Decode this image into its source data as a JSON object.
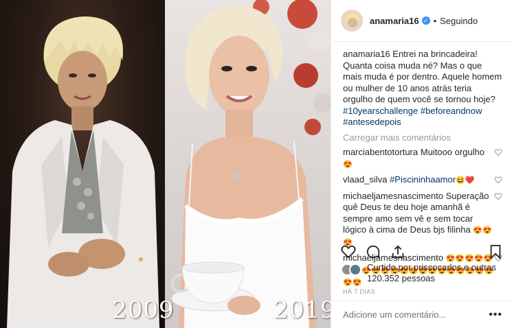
{
  "photo": {
    "year_left": "2009",
    "year_right": "2019"
  },
  "header": {
    "username": "anamaria16",
    "verified_mark": "✓",
    "separator": "•",
    "follow_status": "Seguindo"
  },
  "caption": {
    "username": "anamaria16",
    "text": "Entrei na brincadeira! Quanta coisa muda né? Mas o que mais muda é por dentro. Aquele homem ou mulher de 10 anos atrás teria orgulho de quem você se tornou hoje?",
    "hashtags": [
      "#10yearschallenge",
      "#beforeandnow",
      "#antesedepois"
    ]
  },
  "load_more": "Carregar mais comentários",
  "comments": [
    {
      "username": "marciabentotortura",
      "text": "Muitooo orgulho",
      "emoji": "😍"
    },
    {
      "username": "vlaad_silva",
      "text": "#Piscininhaamor",
      "emoji": "😆❤️"
    },
    {
      "username": "michaeljamesnascimento",
      "text": "Superação quê Deus te deu hoje amanhã é sempre amo sem vê e sem tocar lógico à cima de Deus bjs filinha",
      "emoji": "😍😍😍"
    },
    {
      "username": "michaeljamesnascimento",
      "text": "",
      "emoji": "😍😍😍😍😍😍😍😍😍😍😍😍😍😍😍😍😍😍😍😍😍😍😍"
    }
  ],
  "likes": {
    "text": "Curtido por priscocarlos e outras 120.352 pessoas"
  },
  "date": "HÁ 7 DIAS",
  "add_comment": {
    "placeholder": "Adicione um comentário...",
    "more": "•••"
  },
  "icons": [
    "heart-icon",
    "comment-icon",
    "share-icon",
    "bookmark-icon",
    "heart-small-icon",
    "verified-icon",
    "more-icon"
  ]
}
